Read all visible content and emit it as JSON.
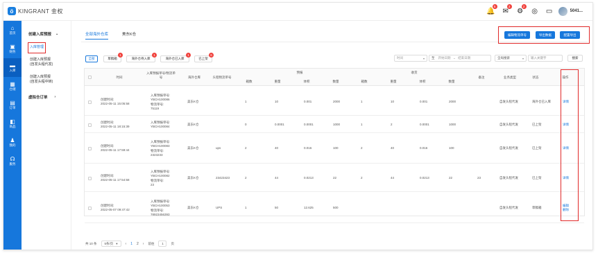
{
  "app": {
    "logo_mark": "ö",
    "brand": "KINGRANT 金权"
  },
  "header": {
    "icons": [
      {
        "name": "bell-icon",
        "glyph": "🔔",
        "badge": "5"
      },
      {
        "name": "message-icon",
        "glyph": "✉",
        "badge": "3"
      },
      {
        "name": "alert-icon",
        "glyph": "⚙",
        "badge": "2"
      },
      {
        "name": "globe-icon",
        "glyph": "◎",
        "badge": ""
      },
      {
        "name": "monitor-icon",
        "glyph": "▭",
        "badge": ""
      }
    ],
    "username": "5041..."
  },
  "sidebar": {
    "items": [
      {
        "glyph": "⌂",
        "label": "首页"
      },
      {
        "glyph": "▣",
        "label": "财务"
      },
      {
        "glyph": "▬",
        "label": "入库"
      },
      {
        "glyph": "▦",
        "label": "仓储"
      },
      {
        "glyph": "▤",
        "label": "订单"
      },
      {
        "glyph": "◧",
        "label": "商品"
      },
      {
        "glyph": "♟",
        "label": "我的"
      },
      {
        "glyph": "☊",
        "label": "服务"
      }
    ]
  },
  "submenu": {
    "group1": "创建入库预报",
    "group1_chevron": "⌄",
    "item1": "入库管理",
    "item2_l1": "创建入库预报",
    "item2_l2": "(自发头程代发)",
    "item3_l1": "创建入库预报",
    "item3_l2": "(自发头程中转)",
    "group2": "虚拟仓订单",
    "group2_chevron": "›"
  },
  "tabs": {
    "tab1": "全部海外仓库",
    "tab2": "美东K仓"
  },
  "actions": {
    "btn1": "编辑物流单号",
    "btn2": "导出数据",
    "btn3": "配置导出"
  },
  "filters": {
    "all": "全部",
    "f1": "草稿箱",
    "f1_badge": "1",
    "f2": "海外仓待入库",
    "f2_badge": "1",
    "f3": "海外仓已入库",
    "f3_badge": "1",
    "f4": "已上架",
    "f4_badge": "6",
    "time_select": "时间",
    "date_from": "开始日期",
    "date_to": "结束日期",
    "date_sep": "至",
    "date_dash": "~",
    "search_select": "全局搜索",
    "keyword": "输入关键字",
    "search_btn": "搜索"
  },
  "table": {
    "headers": {
      "time": "时间",
      "order_no_l1": "入库预报单号/物流单",
      "order_no_l2": "号",
      "warehouse": "海外仓库",
      "logistics": "头程物流单号",
      "forecast": "预报",
      "received": "收货",
      "box": "箱数",
      "weight": "重量",
      "volume": "体积",
      "qty": "数量",
      "remark": "备注",
      "biz_type": "业务类型",
      "status": "状态",
      "op": "操作"
    },
    "rows": [
      {
        "time_label": "创建时间:",
        "time": "2022-05-11 15:05:58",
        "no_label": "入库预报单号:",
        "no": "YBCH100086",
        "track_label": "物流单号:",
        "track": "75119",
        "warehouse": "美东K仓",
        "logistics": "",
        "f_box": "1",
        "f_weight": "10",
        "f_volume": "0.001",
        "f_qty": "2000",
        "r_box": "1",
        "r_weight": "10",
        "r_volume": "0.001",
        "r_qty": "2000",
        "remark": "",
        "biz": "自发头程代发",
        "status": "海外仓已入库",
        "op1": "详情",
        "op2": ""
      },
      {
        "time_label": "创建时间:",
        "time": "2022-05-11 18:15:39",
        "no_label": "入库预报单号:",
        "no": "YBCH100084",
        "track_label": "",
        "track": "",
        "warehouse": "美东K仓",
        "logistics": "",
        "f_box": "0",
        "f_weight": "0.0001",
        "f_volume": "0.0001",
        "f_qty": "1000",
        "r_box": "1",
        "r_weight": "2",
        "r_volume": "0.0001",
        "r_qty": "1000",
        "remark": "",
        "biz": "自发头程代发",
        "status": "已上架",
        "op1": "详情",
        "op2": ""
      },
      {
        "time_label": "创建时间:",
        "time": "2022-05-11 17:59:44",
        "no_label": "入库预报单号:",
        "no": "YBCH100083",
        "track_label": "物流单号:",
        "track": "2323233",
        "warehouse": "美东K仓",
        "logistics": "ups",
        "f_box": "2",
        "f_weight": "40",
        "f_volume": "0.016",
        "f_qty": "100",
        "r_box": "2",
        "r_weight": "40",
        "r_volume": "0.016",
        "r_qty": "100",
        "remark": "",
        "biz": "自发头程代发",
        "status": "已上架",
        "op1": "详情",
        "op2": ""
      },
      {
        "time_label": "创建时间:",
        "time": "2022-05-11 17:54:58",
        "no_label": "入库预报单号:",
        "no": "YBCH100082",
        "track_label": "物流单号:",
        "track": "23",
        "warehouse": "美东K仓",
        "logistics": "23423423",
        "f_box": "2",
        "f_weight": "44",
        "f_volume": "0.0213",
        "f_qty": "22",
        "r_box": "2",
        "r_weight": "44",
        "r_volume": "0.0213",
        "r_qty": "22",
        "remark": "23",
        "biz": "自发头程代发",
        "status": "已上架",
        "op1": "详情",
        "op2": ""
      },
      {
        "time_label": "创建时间:",
        "time": "2022-05-07 09:47:42",
        "no_label": "入库预报单号:",
        "no": "YBCH100053",
        "track_label": "物流单号:",
        "track": "78923456393",
        "warehouse": "美东K仓",
        "logistics": "UPS",
        "f_box": "1",
        "f_weight": "50",
        "f_volume": "12.625",
        "f_qty": "500",
        "r_box": "",
        "r_weight": "",
        "r_volume": "",
        "r_qty": "",
        "remark": "",
        "biz": "自发头程代发",
        "status": "草稿箱",
        "op1": "编辑",
        "op2": "删除"
      }
    ]
  },
  "pager": {
    "total": "共 10 条",
    "page_size": "5条/页",
    "prev": "‹",
    "p1": "1",
    "p2": "2",
    "next": "›",
    "goto": "前往",
    "goto_value": "1",
    "page_unit": "页"
  }
}
